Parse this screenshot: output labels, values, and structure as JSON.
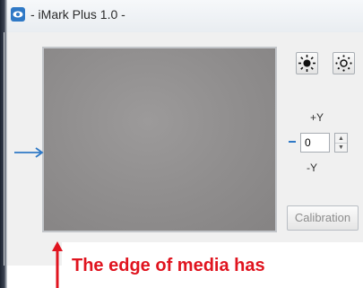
{
  "window": {
    "title": "- iMark Plus 1.0 -"
  },
  "controls": {
    "brightness_up_icon": "brightness-high-icon",
    "brightness_down_icon": "brightness-low-icon",
    "plus_y_label": "+Y",
    "minus_y_label": "-Y",
    "offset_value": "0",
    "calibration_label": "Calibration"
  },
  "annotation": {
    "text": "The edge of media has"
  },
  "colors": {
    "accent_blue": "#2f79c6",
    "annotation_red": "#e0141f"
  }
}
